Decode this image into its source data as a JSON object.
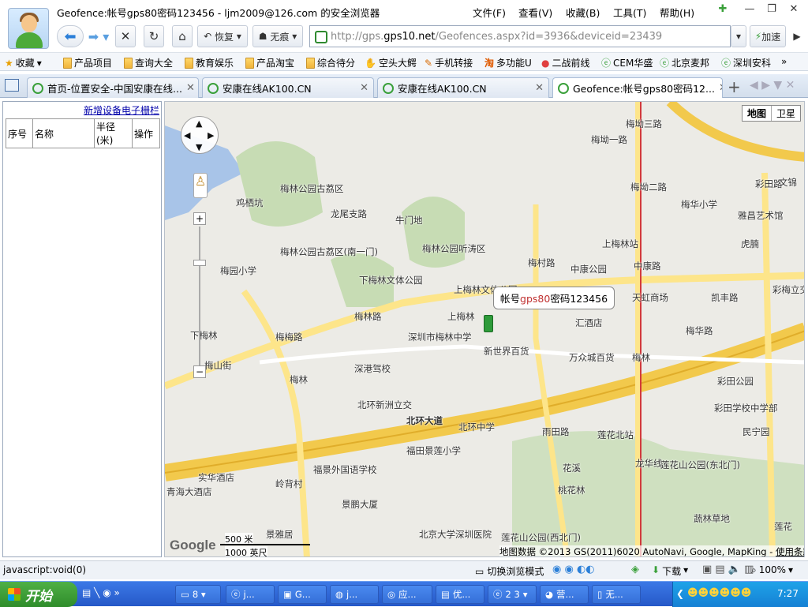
{
  "window": {
    "title": "Geofence:帐号gps80密码123456 - ljm2009@126.com 的安全浏览器",
    "menu": [
      "文件(F)",
      "查看(V)",
      "收藏(B)",
      "工具(T)",
      "帮助(H)"
    ]
  },
  "nav": {
    "restore_label": "恢复",
    "incognito_label": "无痕",
    "url_prefix": "http://gps.",
    "url_domain": "gps10.net",
    "url_suffix": "/Geofences.aspx?id=3936&deviceid=23439",
    "accelerate_label": "加速"
  },
  "bookmarks": {
    "favorites_label": "收藏",
    "items": [
      "产品项目",
      "查询大全",
      "教育娱乐",
      "产品淘宝",
      "综合待分",
      "空头大鳄",
      "手机转接",
      "多功能U",
      "二战前线",
      "CEM华盛",
      "北京麦邦",
      "深圳安科"
    ]
  },
  "tabs": [
    {
      "label": "首页-位置安全-中国安康在线..."
    },
    {
      "label": "安康在线AK100.CN"
    },
    {
      "label": "安康在线AK100.CN"
    },
    {
      "label": "Geofence:帐号gps80密码12..."
    }
  ],
  "sidebar": {
    "new_fence_link": "新增设备电子栅栏",
    "columns": [
      "序号",
      "名称",
      "半径(米)",
      "操作"
    ]
  },
  "map": {
    "type_buttons": [
      "地图",
      "卫星"
    ],
    "marker_label_prefix": "帐号",
    "marker_label_highlight": "gps80",
    "marker_label_suffix": "密码123456",
    "scale_metric": "500 米",
    "scale_imperial": "1000 英尺",
    "logo": "Google",
    "attribution": "地图数据 ©2013 GS(2011)6020 AutoNavi, Google, MapKing -",
    "terms_link": "使用条款",
    "labels": [
      "梅林公园古荔区",
      "鸡栖坑",
      "龙尾支路",
      "牛门地",
      "梅林公园听涛区",
      "梅林公园古荔区(南一门)",
      "梅园小学",
      "下梅林文体公园",
      "上梅林文体公园",
      "上梅林",
      "梅林路",
      "深圳市梅林中学",
      "新世界百货",
      "万众城百货",
      "梅林",
      "下梅林",
      "梅山街",
      "深港驾校",
      "梅林",
      "北环新洲立交",
      "北环大道",
      "北环中学",
      "福田景莲小学",
      "福景外国语学校",
      "实华酒店",
      "青海大酒店",
      "岭背村",
      "景鹏大厦",
      "景雅居",
      "北京大学深圳医院",
      "莲花山公园(西北门)",
      "雨田路",
      "花溪",
      "桃花林",
      "莲花北站",
      "龙华线",
      "莲花山公园(东北门)",
      "蔬林草地",
      "莲花",
      "彩田学校中学部",
      "民宁园",
      "彩田公园",
      "梅华路",
      "彩梅立交",
      "凯丰路",
      "天虹商场",
      "中康路",
      "上梅林站",
      "中康公园",
      "梅华小学",
      "雅昌艺术馆",
      "虎腩",
      "彩田路",
      "文锦",
      "梅坳二路",
      "梅坳一路",
      "梅坳三路",
      "梅村路",
      "汇酒店",
      "梅梅路"
    ]
  },
  "status": {
    "left": "javascript:void(0)",
    "browse_mode": "切换浏览模式",
    "download": "下载",
    "zoom": "100%"
  },
  "taskbar": {
    "start": "开始",
    "items": [
      "8 ▾",
      "j...",
      "G...",
      "j...",
      "应...",
      "优...",
      "2 3",
      "营...",
      "无..."
    ],
    "clock": "7:27"
  }
}
